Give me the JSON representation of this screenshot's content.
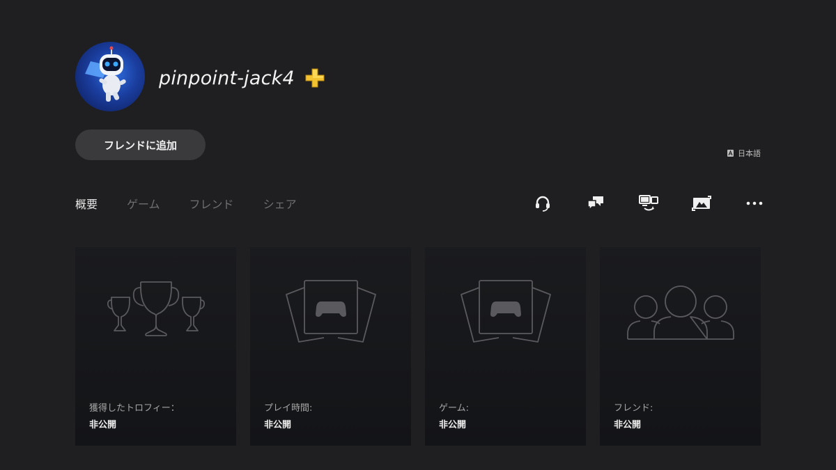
{
  "profile": {
    "username": "pinpoint-jack4",
    "plus_icon": "playstation-plus-icon",
    "avatar": "astro-bot-avatar"
  },
  "add_friend_label": "フレンドに追加",
  "language": {
    "icon": "translate-icon",
    "label": "日本語"
  },
  "tabs": [
    {
      "label": "概要",
      "active": true
    },
    {
      "label": "ゲーム",
      "active": false
    },
    {
      "label": "フレンド",
      "active": false
    },
    {
      "label": "シェア",
      "active": false
    }
  ],
  "actions": [
    {
      "icon": "headset-icon"
    },
    {
      "icon": "chat-bubbles-icon"
    },
    {
      "icon": "share-screen-icon"
    },
    {
      "icon": "game-capture-icon"
    },
    {
      "icon": "more-options-icon"
    }
  ],
  "cards": [
    {
      "icon": "trophies-icon",
      "label": "獲得したトロフィー：",
      "value": "非公開"
    },
    {
      "icon": "game-cards-icon",
      "label": "プレイ時間:",
      "value": "非公開"
    },
    {
      "icon": "game-cards-icon",
      "label": "ゲーム:",
      "value": "非公開"
    },
    {
      "icon": "friends-group-icon",
      "label": "フレンド:",
      "value": "非公開"
    }
  ],
  "colors": {
    "background": "#1f1f21",
    "card": "#16171a",
    "button": "#3a3a3d",
    "plus_gold": "#f2c230"
  }
}
